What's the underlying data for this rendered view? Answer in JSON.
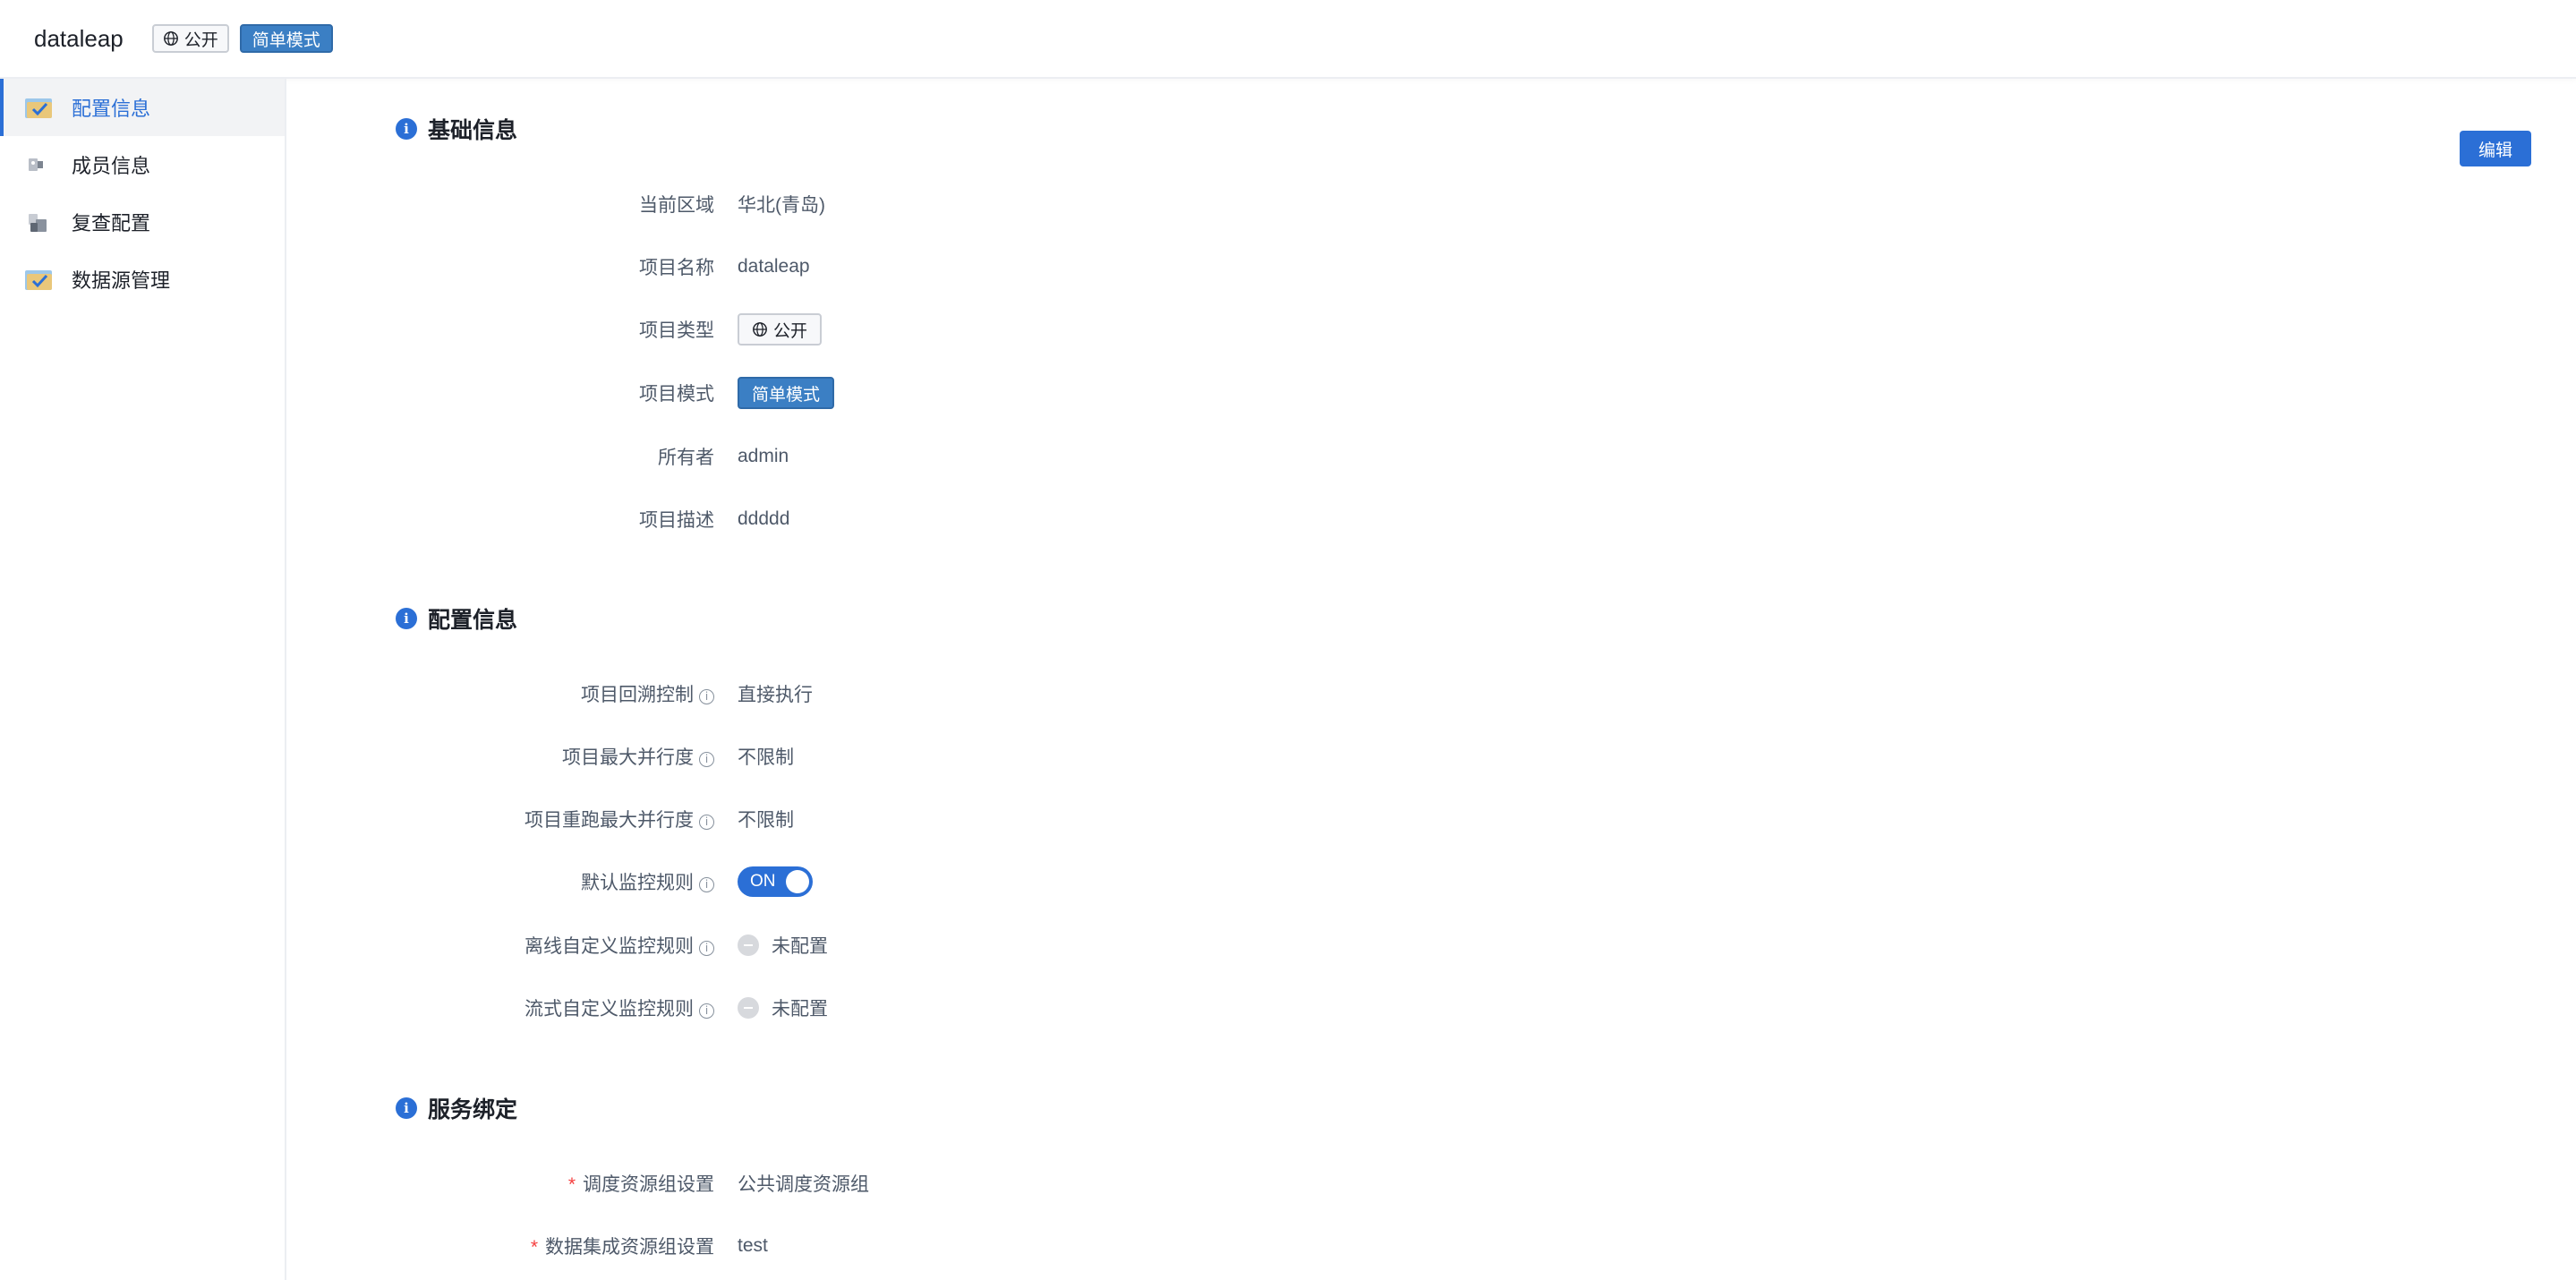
{
  "header": {
    "title": "dataleap",
    "public_tag": "公开",
    "mode_tag": "简单模式"
  },
  "sidebar": {
    "items": [
      {
        "label": "配置信息",
        "active": true
      },
      {
        "label": "成员信息",
        "active": false
      },
      {
        "label": "复查配置",
        "active": false
      },
      {
        "label": "数据源管理",
        "active": false
      }
    ]
  },
  "actions": {
    "edit_label": "编辑"
  },
  "basic": {
    "title": "基础信息",
    "region_label": "当前区域",
    "region_value": "华北(青岛)",
    "name_label": "项目名称",
    "name_value": "dataleap",
    "type_label": "项目类型",
    "type_value": "公开",
    "mode_label": "项目模式",
    "mode_value": "简单模式",
    "owner_label": "所有者",
    "owner_value": "admin",
    "desc_label": "项目描述",
    "desc_value": "ddddd"
  },
  "config": {
    "title": "配置信息",
    "backfill_label": "项目回溯控制",
    "backfill_value": "直接执行",
    "max_parallel_label": "项目最大并行度",
    "max_parallel_value": "不限制",
    "rerun_parallel_label": "项目重跑最大并行度",
    "rerun_parallel_value": "不限制",
    "monitor_label": "默认监控规则",
    "monitor_value": "ON",
    "offline_label": "离线自定义监控规则",
    "offline_value": "未配置",
    "stream_label": "流式自定义监控规则",
    "stream_value": "未配置"
  },
  "binding": {
    "title": "服务绑定",
    "schedule_label": "调度资源组设置",
    "schedule_value": "公共调度资源组",
    "integration_label": "数据集成资源组设置",
    "integration_value": "test"
  },
  "colors": {
    "accent": "#2b6fd6",
    "mode_tag": "#3b7fc4",
    "required": "#f53f3f"
  }
}
